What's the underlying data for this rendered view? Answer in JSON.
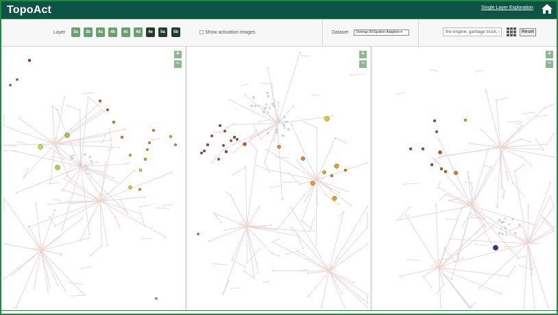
{
  "app": {
    "title": "TopoAct",
    "link": "Single Layer Exploration"
  },
  "controls": {
    "layer_label": "Layer",
    "layers": [
      "3a",
      "3b",
      "4a",
      "4b",
      "4c",
      "4d",
      "4e",
      "5a",
      "5b"
    ],
    "dark_layers": [
      "4e",
      "5a",
      "5b"
    ],
    "show_activation_label": "Show activation images",
    "show_activation_checked": false,
    "dataset_label": "Dataset",
    "dataset_value": "Overlap-30-Epsilon-Adaptive ▾",
    "search_value": "fire engine, garbage truck, i",
    "reset_label": "Reset"
  },
  "zoom": {
    "in": "+",
    "out": "−"
  },
  "colors": {
    "header": "#0d5446",
    "border": "#1f8a3e",
    "edge": "#e7d2da",
    "faint_node": "#f1d9de",
    "cluster_blue": "#c8ccf4",
    "cluster_green": "#cfe8cf"
  },
  "icons": [
    "home-icon",
    "grid-icon",
    "zoom-in-icon",
    "zoom-out-icon"
  ]
}
